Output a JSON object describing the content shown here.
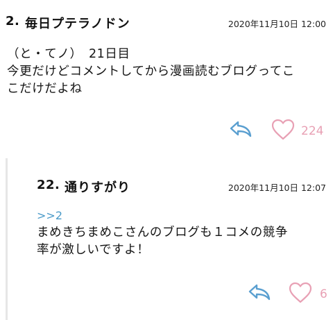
{
  "colors": {
    "reply_icon": "#5a9fd0",
    "like_icon": "#e8a0b4",
    "like_count": "#e8a0b4",
    "anchor_link": "#4a9ac8",
    "thread_line": "#e6e6e6"
  },
  "comments": [
    {
      "number": "2.",
      "name": "毎日プテラノドン",
      "timestamp": "2020年11月10日 12:00",
      "body_lines": [
        "（と・てノ）　21日目",
        "今更だけどコメントしてから漫画読むブログってこ",
        "こだけだよね"
      ],
      "reply_icon": "reply-arrow-icon",
      "like_icon": "heart-outline-icon",
      "likes": "224"
    },
    {
      "number": "22.",
      "name": "通りすがり",
      "timestamp": "2020年11月10日 12:07",
      "anchor": ">>2",
      "body_lines": [
        "まめきちまめこさんのブログも１コメの競争",
        "率が激しいですよ！"
      ],
      "reply_icon": "reply-arrow-icon",
      "like_icon": "heart-outline-icon",
      "likes": "6"
    }
  ]
}
